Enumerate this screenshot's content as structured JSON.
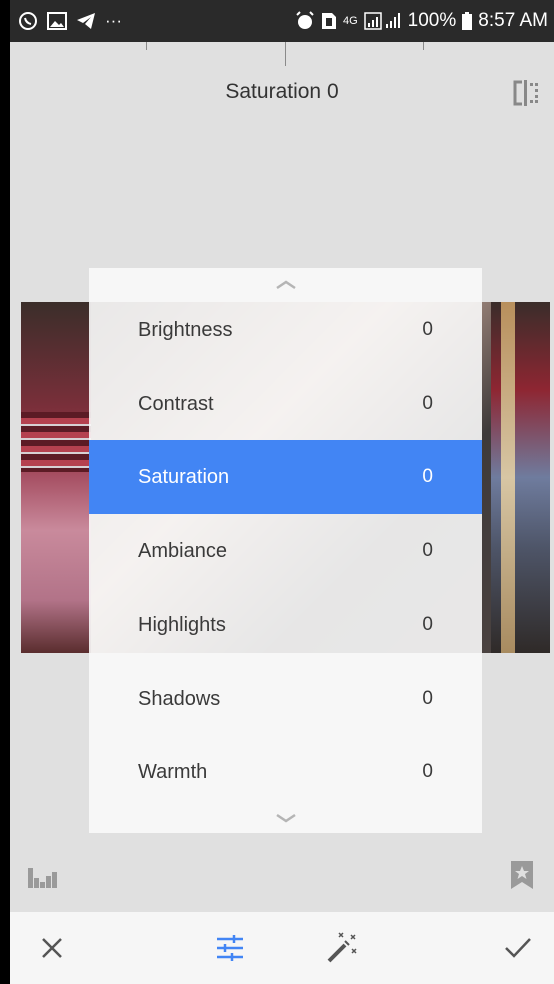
{
  "status_bar": {
    "more_dots": "···",
    "network": "4G",
    "battery": "100%",
    "time": "8:57 AM"
  },
  "title": "Saturation 0",
  "adjustments": [
    {
      "label": "Brightness",
      "value": "0",
      "active": false
    },
    {
      "label": "Contrast",
      "value": "0",
      "active": false
    },
    {
      "label": "Saturation",
      "value": "0",
      "active": true
    },
    {
      "label": "Ambiance",
      "value": "0",
      "active": false
    },
    {
      "label": "Highlights",
      "value": "0",
      "active": false
    },
    {
      "label": "Shadows",
      "value": "0",
      "active": false
    },
    {
      "label": "Warmth",
      "value": "0",
      "active": false
    }
  ],
  "colors": {
    "accent": "#4285f4",
    "status_bar": "#2a2a2a",
    "background": "#e0e0e0"
  },
  "icons": {
    "close": "close-icon",
    "tune": "tune-icon",
    "auto": "magic-wand-icon",
    "apply": "check-icon",
    "histogram": "histogram-icon",
    "bookmark": "bookmark-star-icon",
    "compare": "compare-icon"
  }
}
